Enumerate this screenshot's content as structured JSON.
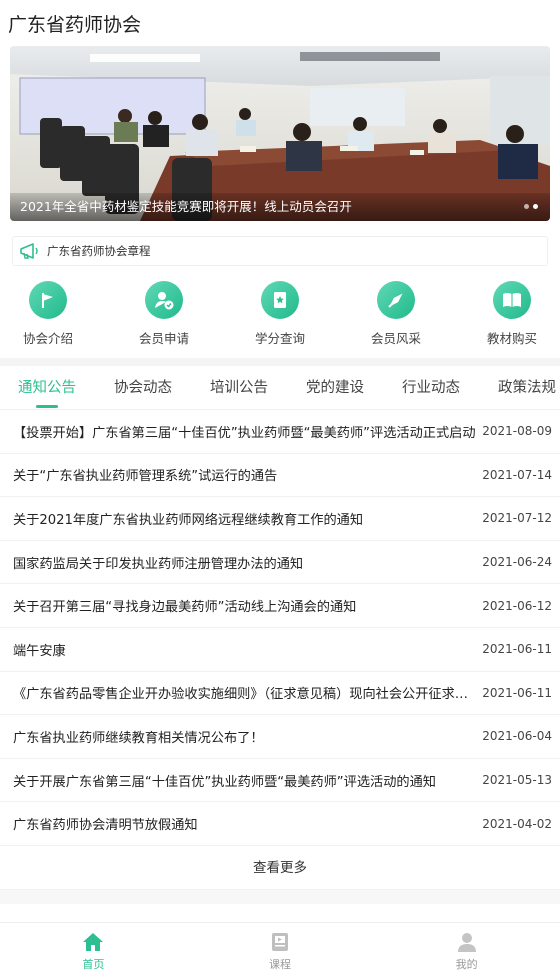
{
  "header": {
    "title": "广东省药师协会"
  },
  "banner": {
    "caption": "2021年全省中药材鉴定技能竞赛即将开展！线上动员会召开",
    "dots": 2,
    "active_dot": 1
  },
  "notice": {
    "text": "广东省药师协会章程",
    "icon": "megaphone-icon"
  },
  "quick_links": [
    {
      "label": "协会介绍",
      "icon": "flag-icon"
    },
    {
      "label": "会员申请",
      "icon": "user-check-icon"
    },
    {
      "label": "学分查询",
      "icon": "bookmark-icon"
    },
    {
      "label": "会员风采",
      "icon": "compass-icon"
    },
    {
      "label": "教材购买",
      "icon": "book-icon"
    }
  ],
  "tabs": [
    "通知公告",
    "协会动态",
    "培训公告",
    "党的建设",
    "行业动态",
    "政策法规"
  ],
  "active_tab": 0,
  "news": [
    {
      "title": "【投票开始】广东省第三届“十佳百优”执业药师暨“最美药师”评选活动正式启动",
      "date": "2021-08-09"
    },
    {
      "title": "关于“广东省执业药师管理系统”试运行的通告",
      "date": "2021-07-14"
    },
    {
      "title": "关于2021年度广东省执业药师网络远程继续教育工作的通知",
      "date": "2021-07-12"
    },
    {
      "title": "国家药监局关于印发执业药师注册管理办法的通知",
      "date": "2021-06-24"
    },
    {
      "title": "关于召开第三届“寻找身边最美药师”活动线上沟通会的通知",
      "date": "2021-06-12"
    },
    {
      "title": "端午安康",
      "date": "2021-06-11"
    },
    {
      "title": "《广东省药品零售企业开办验收实施细则》（征求意见稿）现向社会公开征求意见",
      "date": "2021-06-11"
    },
    {
      "title": "广东省执业药师继续教育相关情况公布了！",
      "date": "2021-06-04"
    },
    {
      "title": "关于开展广东省第三届“十佳百优”执业药师暨“最美药师”评选活动的通知",
      "date": "2021-05-13"
    },
    {
      "title": "广东省药师协会清明节放假通知",
      "date": "2021-04-02"
    }
  ],
  "more_label": "查看更多",
  "tabbar": [
    {
      "label": "首页",
      "icon": "home-icon",
      "active": true
    },
    {
      "label": "课程",
      "icon": "course-icon",
      "active": false
    },
    {
      "label": "我的",
      "icon": "user-icon",
      "active": false
    }
  ],
  "colors": {
    "accent": "#2dbf92",
    "text": "#222222",
    "muted": "#999999"
  }
}
